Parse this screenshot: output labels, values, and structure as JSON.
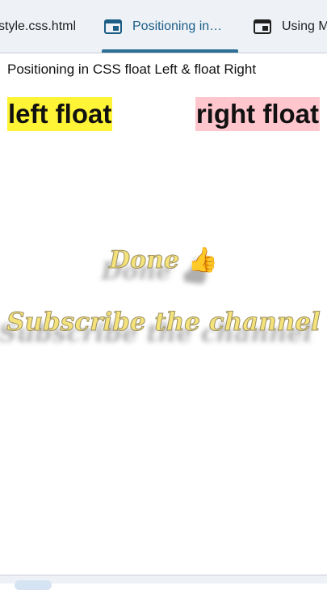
{
  "tabs": [
    {
      "label": "style.css.html",
      "icon": "none",
      "active": false
    },
    {
      "label": "Positioning in…",
      "icon": "window-icon",
      "active": true
    },
    {
      "label": "Using M",
      "icon": "window-icon",
      "active": false
    }
  ],
  "page": {
    "heading": "Positioning in CSS float Left & float Right",
    "left_box": "left float",
    "right_box": "right float",
    "left_box_color": "#fff436",
    "right_box_color": "#ffc6cd"
  },
  "overlay": {
    "done": "Done",
    "thumb": "👍",
    "subscribe": "Subscribe the channel"
  },
  "colors": {
    "accent": "#2e6f96",
    "overlay_text": "#f4e27a"
  }
}
